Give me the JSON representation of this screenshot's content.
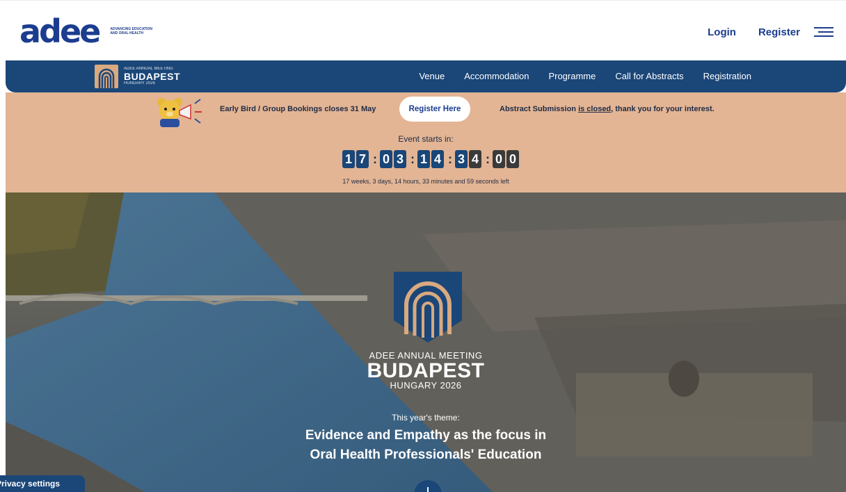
{
  "header": {
    "logo_text": "adee",
    "logo_tagline": "ADVANCING EDUCATION AND ORAL HEALTH",
    "login": "Login",
    "register": "Register"
  },
  "nav": {
    "brand_small": "ADEE ANNUAL MEETING",
    "brand_big": "BUDAPEST",
    "brand_sub": "HUNGARY 2026",
    "items": [
      "Venue",
      "Accommodation",
      "Programme",
      "Call for Abstracts",
      "Registration"
    ]
  },
  "banner": {
    "early_bird": "Early Bird / Group Bookings closes 31 May",
    "register_here": "Register Here",
    "abstract_pre": "Abstract Submission ",
    "abstract_link": "is closed",
    "abstract_post": ", thank you for your interest.",
    "event_starts": "Event starts in:",
    "countdown": {
      "weeks": [
        "1",
        "7"
      ],
      "days": [
        "0",
        "3"
      ],
      "hours": [
        "1",
        "4"
      ],
      "minutes": [
        "3",
        "4"
      ],
      "seconds": [
        "0",
        "0"
      ]
    },
    "time_left": "17 weeks, 3 days, 14 hours, 33 minutes and 59 seconds left"
  },
  "hero": {
    "title_small": "ADEE ANNUAL MEETING",
    "title_big": "BUDAPEST",
    "title_sub": "HUNGARY 2026",
    "theme_label": "This year's theme:",
    "theme_line1": "Evidence and Empathy as the focus in",
    "theme_line2": "Oral Health Professionals' Education"
  },
  "privacy": "Privacy settings",
  "colors": {
    "brand_blue": "#1c3d8f",
    "nav_blue": "#1a4678",
    "banner_peach": "#e3b594",
    "emblem_gold": "#d9a980"
  },
  "icons": {
    "menu": "hamburger-icon",
    "mascot": "bear-megaphone-icon",
    "emblem": "arch-emblem-icon",
    "scroll": "scroll-down-icon"
  }
}
